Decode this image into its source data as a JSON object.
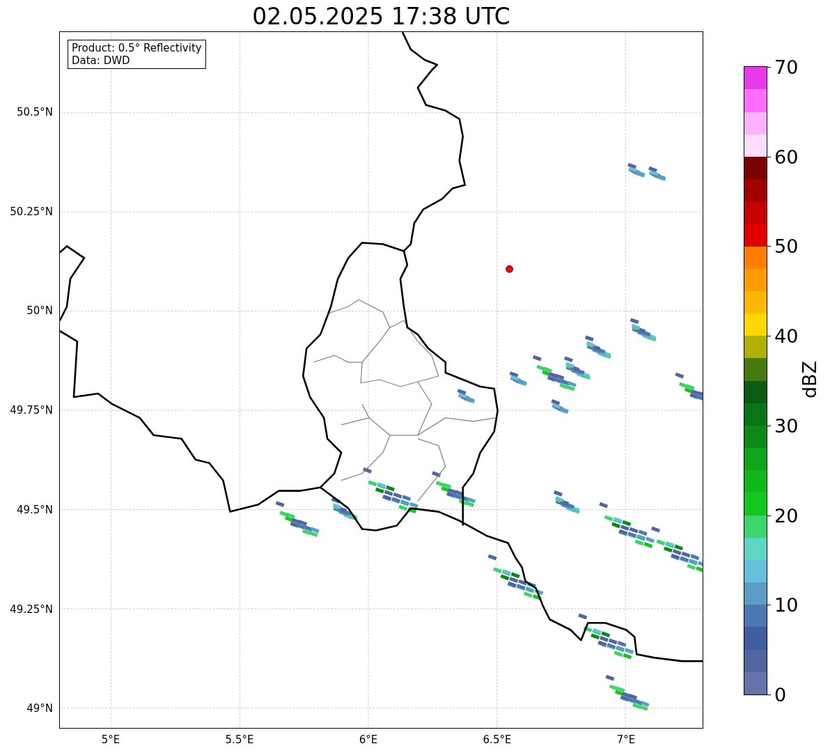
{
  "title": "02.05.2025 17:38 UTC",
  "legend": [
    "Product: 0.5° Reflectivity",
    "Data: DWD"
  ],
  "map": {
    "xticks": [
      "5°E",
      "5.5°E",
      "6°E",
      "6.5°E",
      "7°E"
    ],
    "yticks": [
      "50.5°N",
      "50.25°N",
      "50°N",
      "49.75°N",
      "49.5°N",
      "49.25°N",
      "49°N"
    ]
  },
  "colorbar": {
    "label": "dBZ",
    "ticks": [
      "70",
      "60",
      "50",
      "40",
      "30",
      "20",
      "10",
      "0"
    ],
    "bins": [
      {
        "color": "#6573a8"
      },
      {
        "color": "#5166a0"
      },
      {
        "color": "#405d9f"
      },
      {
        "color": "#4b78b0"
      },
      {
        "color": "#5a9dc6"
      },
      {
        "color": "#64c0dc"
      },
      {
        "color": "#5dd6c4"
      },
      {
        "color": "#3dd46c"
      },
      {
        "color": "#12c81a"
      },
      {
        "color": "#10b81b"
      },
      {
        "color": "#0ea51a"
      },
      {
        "color": "#0b8b16"
      },
      {
        "color": "#0a7516"
      },
      {
        "color": "#0a5c12"
      },
      {
        "color": "#467a0d"
      },
      {
        "color": "#b0b007"
      },
      {
        "color": "#ffd700"
      },
      {
        "color": "#ffb700"
      },
      {
        "color": "#ff9a00"
      },
      {
        "color": "#ff7d00"
      },
      {
        "color": "#e10000"
      },
      {
        "color": "#c40000"
      },
      {
        "color": "#a00000"
      },
      {
        "color": "#7b0000"
      },
      {
        "color": "#ffdfff"
      },
      {
        "color": "#ffb3ff"
      },
      {
        "color": "#ff6cff"
      },
      {
        "color": "#e93ae9"
      }
    ]
  }
}
